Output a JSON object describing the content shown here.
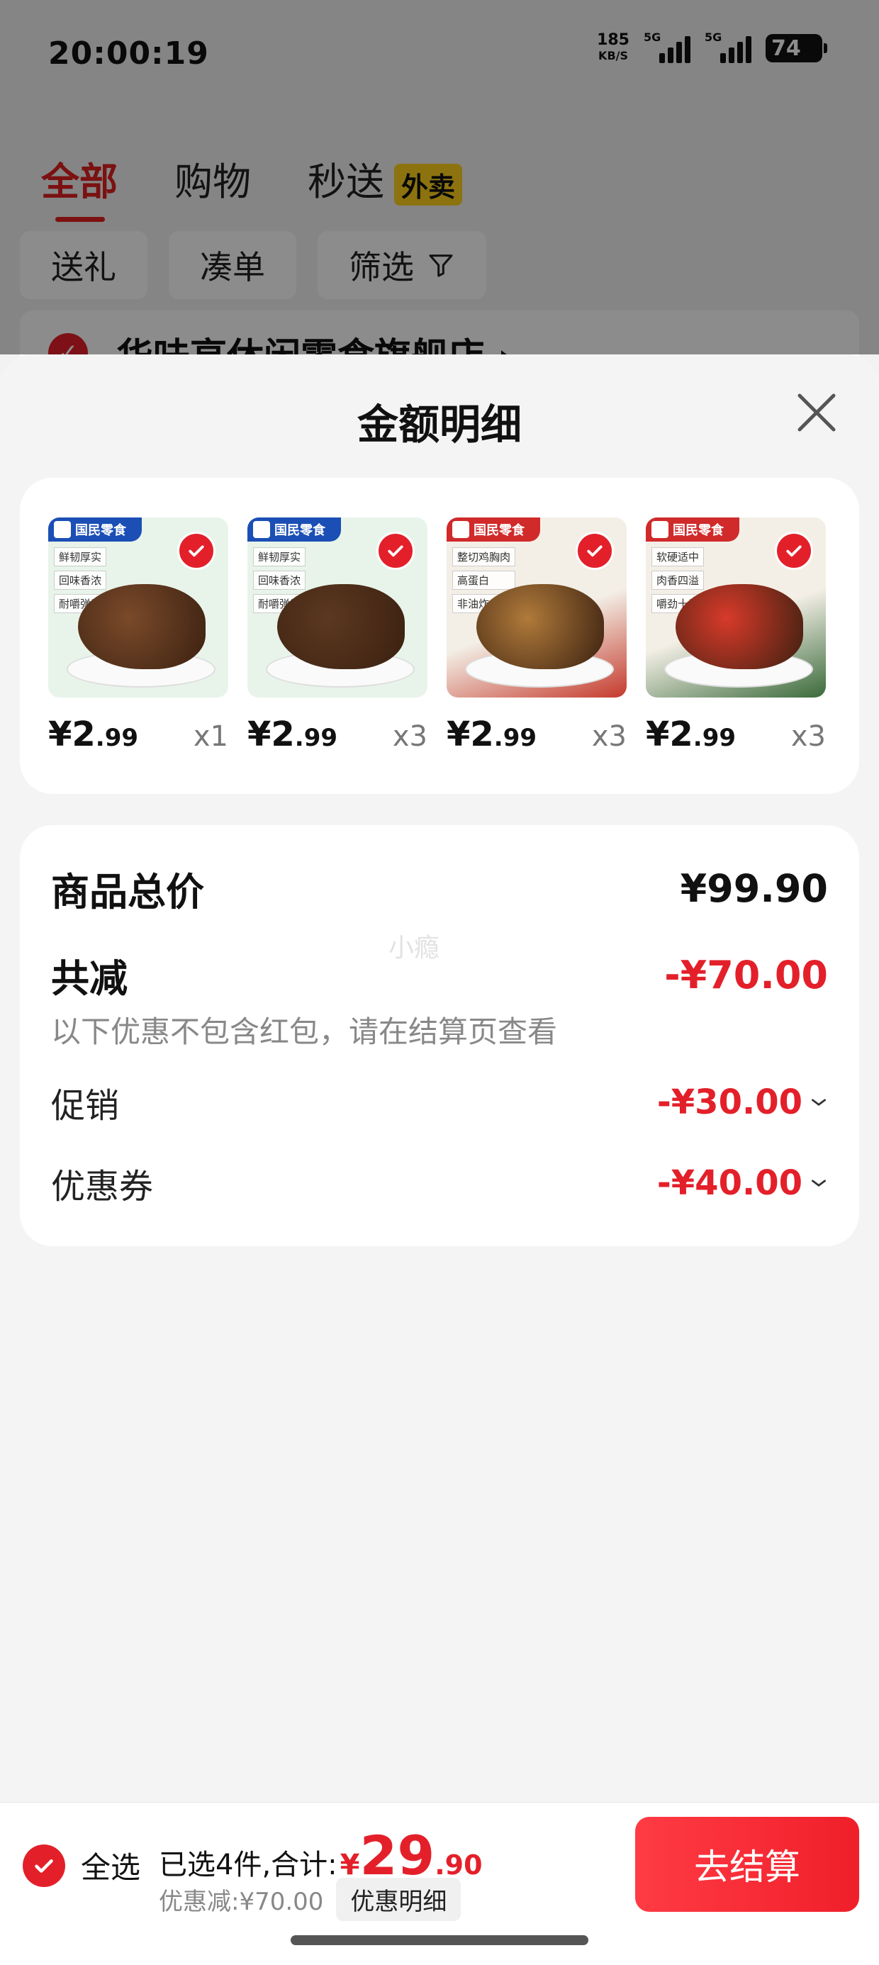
{
  "status_bar": {
    "time": "20:00:19",
    "net_speed": "185",
    "net_unit": "KB/S",
    "signal1_tag": "5G",
    "signal2_tag": "5G",
    "battery": "74"
  },
  "tabs": [
    {
      "label": "全部"
    },
    {
      "label": "购物"
    },
    {
      "label": "秒送",
      "badge": "外卖"
    }
  ],
  "filters": [
    "送礼",
    "凑单",
    "筛选"
  ],
  "store": {
    "name": "华味亨休闲零食旗舰店 ›"
  },
  "sheet": {
    "title": "金额明细",
    "products": [
      {
        "brand": "国民零食",
        "tags": [
          "鲜韧厚实",
          "回味香浓",
          "耐嚼弹牙"
        ],
        "price_int": "¥2",
        "price_dec": ".99",
        "qty": "x1",
        "food_color": "#7a4a2a",
        "bg_color": "#e8f4ea",
        "brand_color": "#1b4fb5"
      },
      {
        "brand": "国民零食",
        "tags": [
          "鲜韧厚实",
          "回味香浓",
          "耐嚼弹牙"
        ],
        "price_int": "¥2",
        "price_dec": ".99",
        "qty": "x3",
        "food_color": "#5c3820",
        "bg_color": "#e8f4ea",
        "brand_color": "#1b4fb5"
      },
      {
        "brand": "国民零食",
        "tags": [
          "整切鸡胸肉",
          "高蛋白",
          "非油炸"
        ],
        "price_int": "¥2",
        "price_dec": ".99",
        "qty": "x3",
        "food_color": "#b07a3a",
        "bg_color": "#c43a2c",
        "brand_color": "#d02a2a"
      },
      {
        "brand": "国民零食",
        "tags": [
          "软硬适中",
          "肉香四溢",
          "嚼劲十足"
        ],
        "price_int": "¥2",
        "price_dec": ".99",
        "qty": "x3",
        "food_color": "#d83a2a",
        "bg_color": "#3a6a3a",
        "brand_color": "#d02a2a"
      }
    ],
    "summary": {
      "total_label": "商品总价",
      "total_value": "¥99.90",
      "reduce_label": "共减",
      "reduce_value": "-¥70.00",
      "note": "以下优惠不包含红包，请在结算页查看",
      "promo_label": "促销",
      "promo_value": "-¥30.00",
      "coupon_label": "优惠券",
      "coupon_value": "-¥40.00",
      "watermark": "小瘾"
    }
  },
  "bottom": {
    "select_all": "全选",
    "selected_prefix": "已选4件,合计:",
    "currency": "¥",
    "total_int": "29",
    "total_dec": ".90",
    "discount": "优惠减:¥70.00",
    "detail_button": "优惠明细",
    "checkout": "去结算"
  },
  "colors": {
    "accent_red": "#e3202a",
    "badge_yellow": "#ffd21e"
  }
}
